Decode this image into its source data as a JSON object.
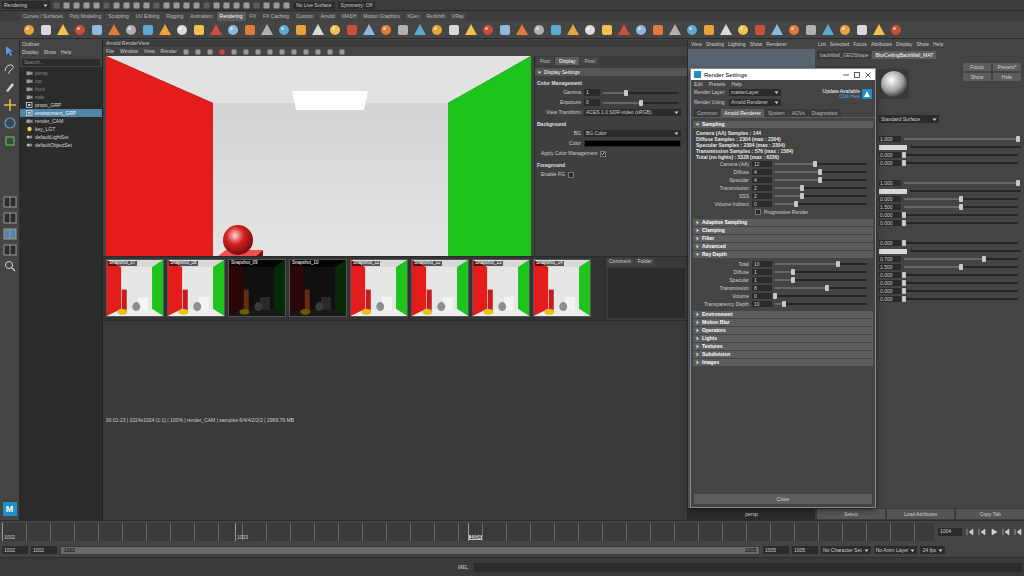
{
  "status_line": {
    "workspace": "Rendering",
    "live_surface": "No Live Surface",
    "symmetry": "Symmetry: Off"
  },
  "shelf": {
    "tabs": [
      {
        "label": "Curves / Surfaces",
        "selected": false
      },
      {
        "label": "Poly Modeling",
        "selected": false
      },
      {
        "label": "Sculpting",
        "selected": false
      },
      {
        "label": "UV Editing",
        "selected": false
      },
      {
        "label": "Rigging",
        "selected": false
      },
      {
        "label": "Animation",
        "selected": false
      },
      {
        "label": "Rendering",
        "selected": true
      },
      {
        "label": "FX",
        "selected": false
      },
      {
        "label": "FX Caching",
        "selected": false
      },
      {
        "label": "Custom",
        "selected": false
      },
      {
        "label": "Arnold",
        "selected": false
      },
      {
        "label": "MASH",
        "selected": false
      },
      {
        "label": "Motion Graphics",
        "selected": false
      },
      {
        "label": "XGen",
        "selected": false
      },
      {
        "label": "Redshift",
        "selected": false
      },
      {
        "label": "VRay",
        "selected": false
      }
    ]
  },
  "toolbox": {
    "logo": "M"
  },
  "outliner": {
    "title": "Outliner",
    "menus": [
      "Display",
      "Show",
      "Help"
    ],
    "search": {
      "placeholder": "Search..."
    },
    "items": [
      {
        "label": "persp",
        "kind": "camera",
        "dimmed": true,
        "selected": false
      },
      {
        "label": "top",
        "kind": "camera",
        "dimmed": true,
        "selected": false
      },
      {
        "label": "front",
        "kind": "camera",
        "dimmed": true,
        "selected": false
      },
      {
        "label": "side",
        "kind": "camera",
        "dimmed": true,
        "selected": false
      },
      {
        "label": "props_GRP",
        "kind": "group",
        "dimmed": false,
        "selected": false
      },
      {
        "label": "environment_GRP",
        "kind": "group",
        "dimmed": false,
        "selected": true
      },
      {
        "label": "render_CAM",
        "kind": "camera",
        "dimmed": false,
        "selected": false
      },
      {
        "label": "key_LGT",
        "kind": "light",
        "dimmed": false,
        "selected": false
      },
      {
        "label": "defaultLightSet",
        "kind": "set",
        "dimmed": false,
        "selected": false
      },
      {
        "label": "defaultObjectSet",
        "kind": "set",
        "dimmed": false,
        "selected": false
      }
    ]
  },
  "render_view": {
    "title": "Arnold RenderView",
    "menus": [
      "File",
      "Window",
      "View",
      "Render"
    ],
    "panel_tabs": [
      {
        "label": "Post",
        "selected": false
      },
      {
        "label": "Display",
        "selected": true
      },
      {
        "label": "Pixel",
        "selected": false
      }
    ],
    "display_settings": {
      "title": "Display Settings",
      "color_management": {
        "title": "Color Management",
        "gamma": {
          "label": "Gamma",
          "value": "1",
          "level": 0.3
        },
        "exposure": {
          "label": "Exposure",
          "value": "0",
          "level": 0.5
        },
        "view_transform": {
          "label": "View Transform",
          "value": "ACES 1.0 SDR-video (sRGB)"
        }
      },
      "background": {
        "title": "Background",
        "bg": {
          "label": "BG",
          "value": "BG Color"
        },
        "color": {
          "label": "Color"
        },
        "apply_cm": {
          "label": "Apply Color Management",
          "checked": true
        }
      },
      "foreground": {
        "title": "Foreground",
        "enable_fg": {
          "label": "Enable FG",
          "checked": false
        }
      }
    },
    "snapshots": [
      {
        "label": "Snapshot_07",
        "kind": "lit"
      },
      {
        "label": "Snapshot_08",
        "kind": "lit"
      },
      {
        "label": "Snapshot_09",
        "kind": "dark"
      },
      {
        "label": "Snapshot_10",
        "kind": "dark"
      },
      {
        "label": "Snapshot_11",
        "kind": "lit"
      },
      {
        "label": "Snapshot_12",
        "kind": "lit"
      },
      {
        "label": "Snapshot_13",
        "kind": "lit"
      },
      {
        "label": "Snapshot_14",
        "kind": "lit"
      }
    ],
    "side_tabs": [
      "Comment",
      "Folder"
    ],
    "status": "00:01:23 | 1024x1024 (1:1) | 100% | render_CAM | samples 6/4/4/2/2/2 | 2969.79 MB"
  },
  "viewport": {
    "menus": [
      "View",
      "Shading",
      "Lighting",
      "Show",
      "Renderer"
    ],
    "camera": "persp"
  },
  "render_settings": {
    "title": "Render Settings",
    "menus": [
      "Edit",
      "Presets",
      "Help"
    ],
    "render_layer": {
      "label": "Render Layer",
      "value": "masterLayer"
    },
    "render_using": {
      "label": "Render Using",
      "value": "Arnold Renderer"
    },
    "update": {
      "label": "Update Available",
      "link": "Click Here"
    },
    "tabs": [
      {
        "label": "Common",
        "selected": false
      },
      {
        "label": "Arnold Renderer",
        "selected": true
      },
      {
        "label": "System",
        "selected": false
      },
      {
        "label": "AOVs",
        "selected": false
      },
      {
        "label": "Diagnostics",
        "selected": false
      }
    ],
    "sections": [
      {
        "label": "Sampling",
        "expanded": true,
        "info": [
          "Camera (AA) Samples : 144",
          "Diffuse Samples : 2304 (max : 2304)",
          "Specular Samples : 2304 (max : 2304)",
          "Transmission Samples : 576 (max : 1584)",
          "Total (no lights) : 5328 (max : 6336)"
        ],
        "sliders": [
          {
            "label": "Camera (AA)",
            "value": "12",
            "level": 0.43
          },
          {
            "label": "Diffuse",
            "value": "4",
            "level": 0.49
          },
          {
            "label": "Specular",
            "value": "4",
            "level": 0.49
          },
          {
            "label": "Transmission",
            "value": "2",
            "level": 0.29
          },
          {
            "label": "SSS",
            "value": "2",
            "level": 0.29
          },
          {
            "label": "Volume Indirect",
            "value": "0",
            "level": 0.23
          }
        ],
        "checkbox": {
          "label": "Progressive Render",
          "checked": false
        }
      },
      {
        "label": "Adaptive Sampling",
        "expanded": false
      },
      {
        "label": "Clamping",
        "expanded": false
      },
      {
        "label": "Filter",
        "expanded": false
      },
      {
        "label": "Advanced",
        "expanded": false
      },
      {
        "label": "Ray Depth",
        "expanded": true,
        "sliders": [
          {
            "label": "Total",
            "value": "10",
            "level": 0.68
          },
          {
            "label": "Diffuse",
            "value": "1",
            "level": 0.2
          },
          {
            "label": "Specular",
            "value": "1",
            "level": 0.2
          },
          {
            "label": "Transmission",
            "value": "8",
            "level": 0.56
          },
          {
            "label": "Volume",
            "value": "0",
            "level": 0.0
          },
          {
            "label": "Transparency Depth",
            "value": "10",
            "level": 0.1
          }
        ]
      },
      {
        "label": "Environment",
        "expanded": false
      },
      {
        "label": "Motion Blur",
        "expanded": false
      },
      {
        "label": "Operators",
        "expanded": false
      },
      {
        "label": "Lights",
        "expanded": false
      },
      {
        "label": "Textures",
        "expanded": false
      },
      {
        "label": "Subdivision",
        "expanded": false
      },
      {
        "label": "Images",
        "expanded": false
      }
    ],
    "close": "Close"
  },
  "attribute_editor": {
    "menus": [
      "List",
      "Selected",
      "Focus",
      "Attributes",
      "Display",
      "Show",
      "Help"
    ],
    "tabs": [
      {
        "label": "backWall_GEOShape",
        "selected": false
      },
      {
        "label": "BlurCeilingBackWall_MAT",
        "selected": true
      }
    ],
    "buttons": [
      "Focus",
      "Presets*",
      "Show",
      "Hide"
    ],
    "shader_type": "Standard Surface",
    "groups": [
      [
        {
          "kind": "slider",
          "value": "1.000",
          "level": 1.0
        },
        {
          "kind": "color"
        },
        {
          "kind": "slider",
          "value": "0.000",
          "level": 0.0
        },
        {
          "kind": "slider",
          "value": "0.000",
          "level": 0.0
        }
      ],
      [
        {
          "kind": "slider",
          "value": "1.000",
          "level": 1.0
        },
        {
          "kind": "color"
        },
        {
          "kind": "slider",
          "value": "0.000",
          "level": 0.5
        },
        {
          "kind": "slider",
          "value": "1.500",
          "level": 0.5
        },
        {
          "kind": "slider",
          "value": "0.000",
          "level": 0.0
        },
        {
          "kind": "slider",
          "value": "0.000",
          "level": 0.0
        }
      ],
      [
        {
          "kind": "slider",
          "value": "0.000",
          "level": 0.0
        },
        {
          "kind": "color"
        },
        {
          "kind": "slider",
          "value": "0.700",
          "level": 0.7
        },
        {
          "kind": "slider",
          "value": "1.500",
          "level": 0.5
        },
        {
          "kind": "slider",
          "value": "0.000",
          "level": 0.0
        },
        {
          "kind": "slider",
          "value": "0.000",
          "level": 0.0
        },
        {
          "kind": "slider",
          "value": "0.000",
          "level": 0.0
        },
        {
          "kind": "slider",
          "value": "0.000",
          "level": 0.0
        }
      ]
    ],
    "footer": [
      "Select",
      "Load Attributes",
      "Copy Tab"
    ]
  },
  "timeline": {
    "ticks": [
      {
        "label": "1002",
        "selected": false
      },
      {
        "label": "1003",
        "selected": false
      },
      {
        "label": "1004",
        "selected": true
      }
    ],
    "current_frame": "1004"
  },
  "range": {
    "start": "1002",
    "playback_start": "1002",
    "bar_start": "1002",
    "bar_end": "1005",
    "playback_end": "1005",
    "end": "1005",
    "character_set": "No Character Set",
    "anim_layer": "No Anim Layer",
    "fps": "24 fps"
  },
  "command_line": {
    "language": "MEL"
  }
}
